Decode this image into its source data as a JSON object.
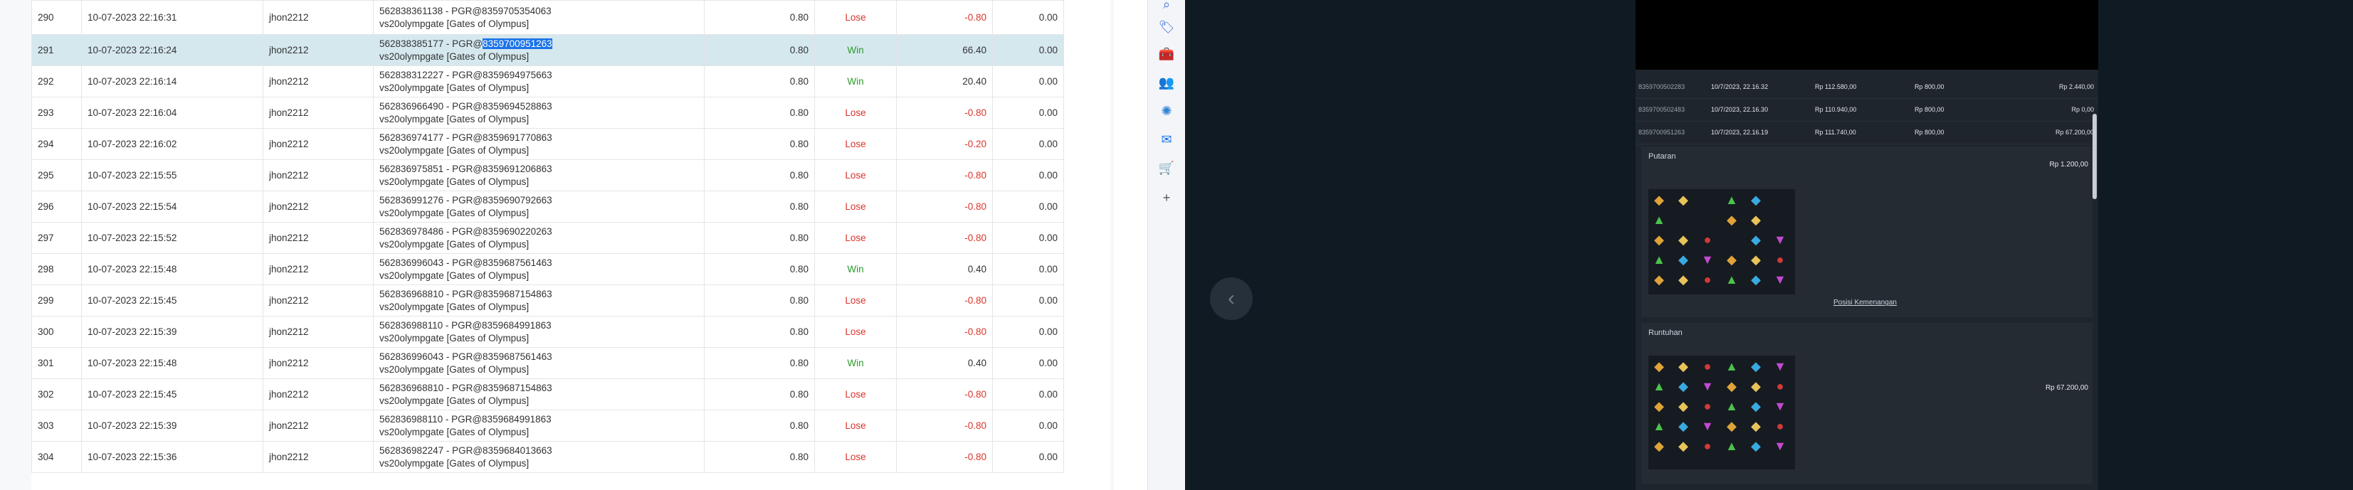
{
  "table": {
    "rows": [
      {
        "no": "290",
        "time": "10-07-2023 22:16:31",
        "user": "jhon2212",
        "tx1": "562838361138 - PGR@8359705354063",
        "tx2": "vs20olympgate [Gates of Olympus]",
        "bet": "0.80",
        "result": "Lose",
        "win": "-0.80",
        "extra": "0.00"
      },
      {
        "no": "291",
        "time": "10-07-2023 22:16:24",
        "user": "jhon2212",
        "tx1_prefix": "562838385177 - PGR@",
        "tx1_highlight": "8359700951263",
        "tx2": "vs20olympgate [Gates of Olympus]",
        "bet": "0.80",
        "result": "Win",
        "win": "66.40",
        "extra": "0.00"
      },
      {
        "no": "292",
        "time": "10-07-2023 22:16:14",
        "user": "jhon2212",
        "tx1": "562838312227 - PGR@8359694975663",
        "tx2": "vs20olympgate [Gates of Olympus]",
        "bet": "0.80",
        "result": "Win",
        "win": "20.40",
        "extra": "0.00"
      },
      {
        "no": "293",
        "time": "10-07-2023 22:16:04",
        "user": "jhon2212",
        "tx1": "562836966490 - PGR@8359694528863",
        "tx2": "vs20olympgate [Gates of Olympus]",
        "bet": "0.80",
        "result": "Lose",
        "win": "-0.80",
        "extra": "0.00"
      },
      {
        "no": "294",
        "time": "10-07-2023 22:16:02",
        "user": "jhon2212",
        "tx1": "562836974177 - PGR@8359691770863",
        "tx2": "vs20olympgate [Gates of Olympus]",
        "bet": "0.80",
        "result": "Lose",
        "win": "-0.20",
        "extra": "0.00"
      },
      {
        "no": "295",
        "time": "10-07-2023 22:15:55",
        "user": "jhon2212",
        "tx1": "562836975851 - PGR@8359691206863",
        "tx2": "vs20olympgate [Gates of Olympus]",
        "bet": "0.80",
        "result": "Lose",
        "win": "-0.80",
        "extra": "0.00"
      },
      {
        "no": "296",
        "time": "10-07-2023 22:15:54",
        "user": "jhon2212",
        "tx1": "562836991276 - PGR@8359690792663",
        "tx2": "vs20olympgate [Gates of Olympus]",
        "bet": "0.80",
        "result": "Lose",
        "win": "-0.80",
        "extra": "0.00"
      },
      {
        "no": "297",
        "time": "10-07-2023 22:15:52",
        "user": "jhon2212",
        "tx1": "562836978486 - PGR@8359690220263",
        "tx2": "vs20olympgate [Gates of Olympus]",
        "bet": "0.80",
        "result": "Lose",
        "win": "-0.80",
        "extra": "0.00"
      },
      {
        "no": "298",
        "time": "10-07-2023 22:15:48",
        "user": "jhon2212",
        "tx1": "562836996043 - PGR@8359687561463",
        "tx2": "vs20olympgate [Gates of Olympus]",
        "bet": "0.80",
        "result": "Win",
        "win": "0.40",
        "extra": "0.00"
      },
      {
        "no": "299",
        "time": "10-07-2023 22:15:45",
        "user": "jhon2212",
        "tx1": "562836968810 - PGR@8359687154863",
        "tx2": "vs20olympgate [Gates of Olympus]",
        "bet": "0.80",
        "result": "Lose",
        "win": "-0.80",
        "extra": "0.00"
      },
      {
        "no": "300",
        "time": "10-07-2023 22:15:39",
        "user": "jhon2212",
        "tx1": "562836988110 - PGR@8359684991863",
        "tx2": "vs20olympgate [Gates of Olympus]",
        "bet": "0.80",
        "result": "Lose",
        "win": "-0.80",
        "extra": "0.00"
      },
      {
        "no": "301",
        "time": "10-07-2023 22:15:48",
        "user": "jhon2212",
        "tx1": "562836996043 - PGR@8359687561463",
        "tx2": "vs20olympgate [Gates of Olympus]",
        "bet": "0.80",
        "result": "Win",
        "win": "0.40",
        "extra": "0.00"
      },
      {
        "no": "302",
        "time": "10-07-2023 22:15:45",
        "user": "jhon2212",
        "tx1": "562836968810 - PGR@8359687154863",
        "tx2": "vs20olympgate [Gates of Olympus]",
        "bet": "0.80",
        "result": "Lose",
        "win": "-0.80",
        "extra": "0.00"
      },
      {
        "no": "303",
        "time": "10-07-2023 22:15:39",
        "user": "jhon2212",
        "tx1": "562836988110 - PGR@8359684991863",
        "tx2": "vs20olympgate [Gates of Olympus]",
        "bet": "0.80",
        "result": "Lose",
        "win": "-0.80",
        "extra": "0.00"
      },
      {
        "no": "304",
        "time": "10-07-2023 22:15:36",
        "user": "jhon2212",
        "tx1": "562836982247 - PGR@8359684013663",
        "tx2": "vs20olympgate [Gates of Olympus]",
        "bet": "0.80",
        "result": "Lose",
        "win": "-0.80",
        "extra": "0.00"
      }
    ]
  },
  "sidebar": {
    "icons": [
      "search-icon",
      "tag-icon",
      "toolbox-icon",
      "people-icon",
      "copilot-icon",
      "outlook-icon",
      "shopping-icon",
      "add-icon"
    ]
  },
  "history_panel": {
    "rows": [
      {
        "id": "8359700502283",
        "date": "10/7/2023, 22.16.32",
        "balance": "Rp 112.580,00",
        "bet": "Rp 800,00",
        "win": "Rp 2.440,00"
      },
      {
        "id": "8359700502483",
        "date": "10/7/2023, 22.16.30",
        "balance": "Rp 110.940,00",
        "bet": "Rp 800,00",
        "win": "Rp 0,00"
      },
      {
        "id": "8359700951263",
        "date": "10/7/2023, 22.16.19",
        "balance": "Rp 111.740,00",
        "bet": "Rp 800,00",
        "win": "Rp 67.200,00"
      }
    ],
    "putaran": {
      "title": "Putaran",
      "amount": "Rp 1.200,00",
      "link": "Posisi Kemenangan"
    },
    "runtuhan": {
      "title": "Runtuhan",
      "amount": "Rp 67.200,00"
    }
  },
  "colors": {
    "win": "#2c9a2c",
    "lose": "#d9342b",
    "selected_row": "#d5e8ee",
    "highlight": "#1b73e8",
    "dark_bg": "#101a23",
    "panel_bg": "#1f252c"
  }
}
